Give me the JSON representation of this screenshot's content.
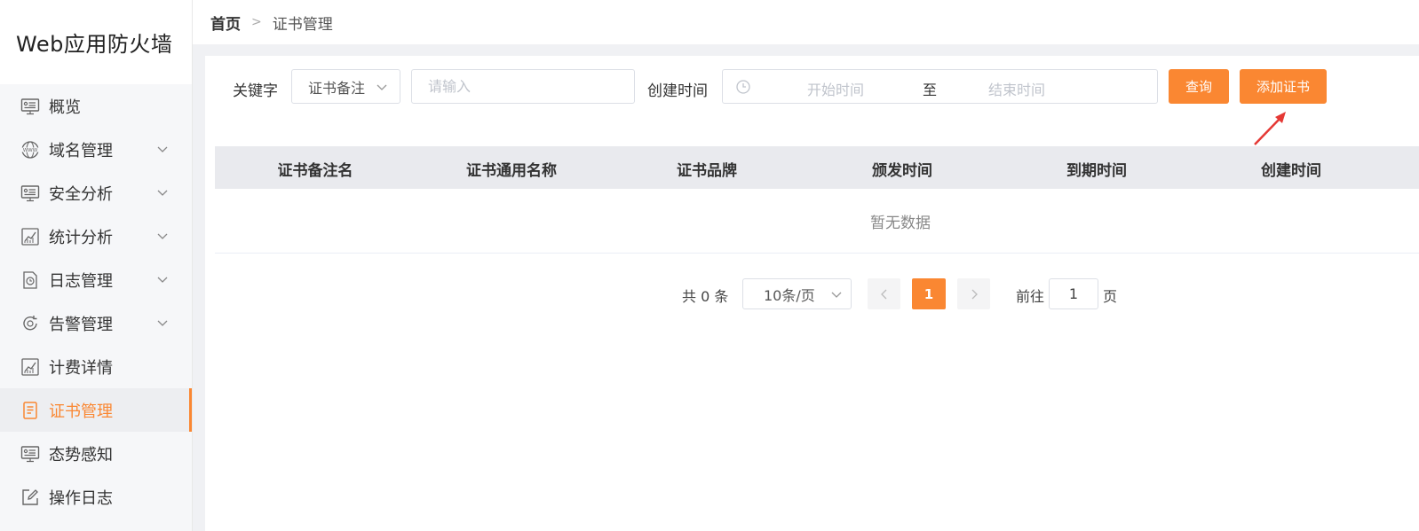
{
  "app": {
    "title": "Web应用防火墙"
  },
  "sidebar": {
    "items": [
      {
        "label": "概览",
        "icon": "monitor-icon",
        "expandable": false,
        "active": false
      },
      {
        "label": "域名管理",
        "icon": "globe-www-icon",
        "expandable": true,
        "active": false
      },
      {
        "label": "安全分析",
        "icon": "monitor-icon",
        "expandable": true,
        "active": false
      },
      {
        "label": "统计分析",
        "icon": "line-chart-icon",
        "expandable": true,
        "active": false
      },
      {
        "label": "日志管理",
        "icon": "log-file-icon",
        "expandable": true,
        "active": false
      },
      {
        "label": "告警管理",
        "icon": "alarm-refresh-icon",
        "expandable": true,
        "active": false
      },
      {
        "label": "计费详情",
        "icon": "line-chart-icon",
        "expandable": false,
        "active": false
      },
      {
        "label": "证书管理",
        "icon": "certificate-icon",
        "expandable": false,
        "active": true
      },
      {
        "label": "态势感知",
        "icon": "monitor-icon",
        "expandable": false,
        "active": false
      },
      {
        "label": "操作日志",
        "icon": "edit-icon",
        "expandable": false,
        "active": false
      }
    ]
  },
  "breadcrumb": {
    "home": "首页",
    "separator": ">",
    "current": "证书管理"
  },
  "filters": {
    "keyword_label": "关键字",
    "keyword_select_value": "证书备注",
    "keyword_input_placeholder": "请输入",
    "created_time_label": "创建时间",
    "start_placeholder": "开始时间",
    "range_separator": "至",
    "end_placeholder": "结束时间"
  },
  "buttons": {
    "query": "查询",
    "add_certificate": "添加证书"
  },
  "table": {
    "headers": [
      "证书备注名",
      "证书通用名称",
      "证书品牌",
      "颁发时间",
      "到期时间",
      "创建时间"
    ],
    "rows": [],
    "empty_text": "暂无数据"
  },
  "pagination": {
    "total_text": "共 0 条",
    "page_size": "10条/页",
    "current_page": "1",
    "goto_label": "前往",
    "goto_value": "1",
    "page_suffix": "页"
  },
  "colors": {
    "accent": "#fa8732",
    "annotation": "#e53935",
    "header_bg": "#e9eaee"
  }
}
